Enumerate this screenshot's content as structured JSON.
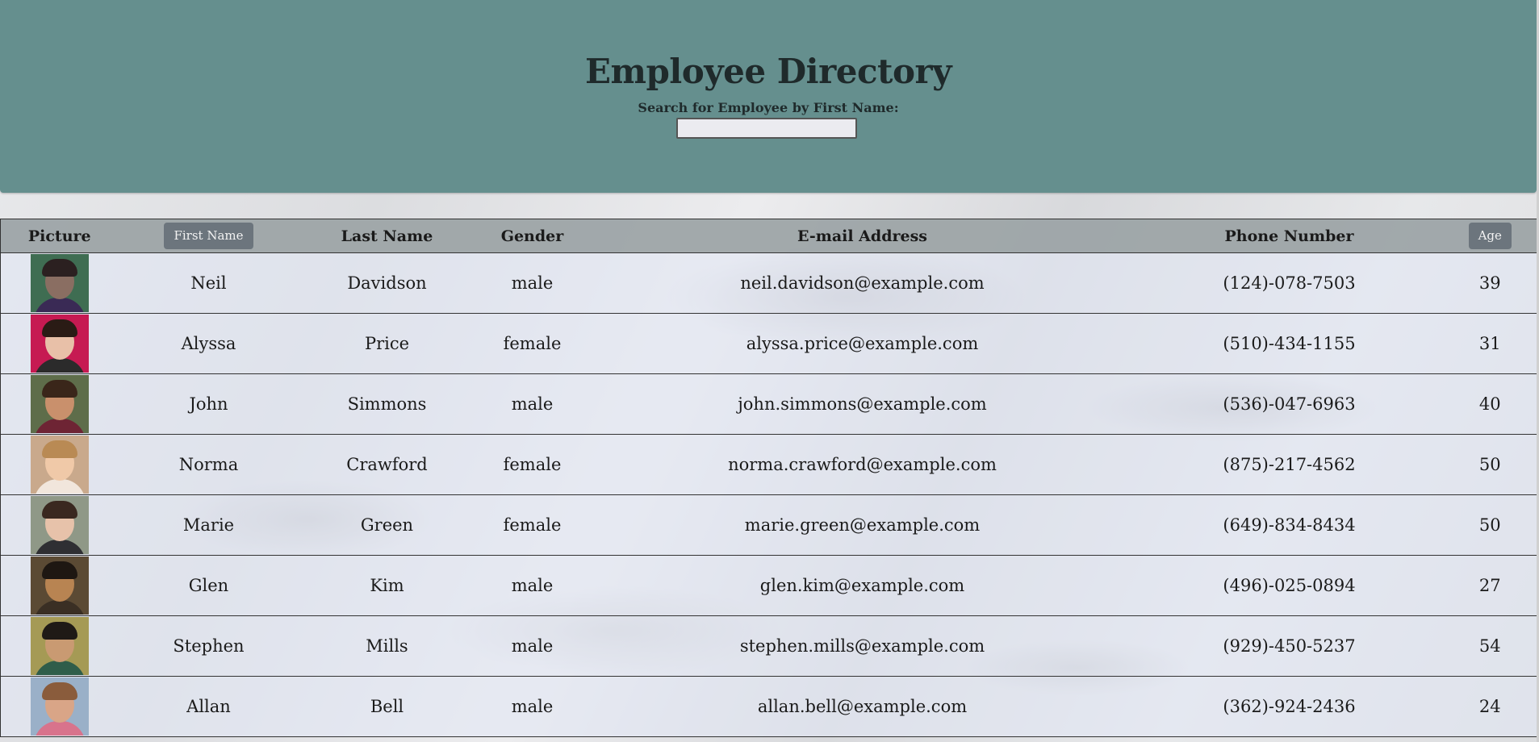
{
  "header": {
    "title": "Employee Directory",
    "search_label": "Search for Employee by First Name:",
    "search_value": "",
    "search_placeholder": ""
  },
  "table": {
    "columns": {
      "picture": "Picture",
      "first_name": "First Name",
      "last_name": "Last Name",
      "gender": "Gender",
      "email": "E-mail Address",
      "phone": "Phone Number",
      "age": "Age"
    },
    "rows": [
      {
        "first": "Neil",
        "last": "Davidson",
        "gender": "male",
        "email": "neil.davidson@example.com",
        "phone": "(124)-078-7503",
        "age": "39",
        "bg": "#3f6d52",
        "skin": "#8a6e62",
        "hair": "#2b2020",
        "shirt": "#3a2a55"
      },
      {
        "first": "Alyssa",
        "last": "Price",
        "gender": "female",
        "email": "alyssa.price@example.com",
        "phone": "(510)-434-1155",
        "age": "31",
        "bg": "#c61a52",
        "skin": "#e8c0a8",
        "hair": "#2a1b15",
        "shirt": "#2b2b2b"
      },
      {
        "first": "John",
        "last": "Simmons",
        "gender": "male",
        "email": "john.simmons@example.com",
        "phone": "(536)-047-6963",
        "age": "40",
        "bg": "#5e6d4a",
        "skin": "#c9906c",
        "hair": "#3a261a",
        "shirt": "#6e2434"
      },
      {
        "first": "Norma",
        "last": "Crawford",
        "gender": "female",
        "email": "norma.crawford@example.com",
        "phone": "(875)-217-4562",
        "age": "50",
        "bg": "#c9a98c",
        "skin": "#f0c9a8",
        "hair": "#b98a54",
        "shirt": "#f1e6dc"
      },
      {
        "first": "Marie",
        "last": "Green",
        "gender": "female",
        "email": "marie.green@example.com",
        "phone": "(649)-834-8434",
        "age": "50",
        "bg": "#8f9887",
        "skin": "#e7c2aa",
        "hair": "#3a2820",
        "shirt": "#2f2f33"
      },
      {
        "first": "Glen",
        "last": "Kim",
        "gender": "male",
        "email": "glen.kim@example.com",
        "phone": "(496)-025-0894",
        "age": "27",
        "bg": "#5b4a34",
        "skin": "#b88452",
        "hair": "#1e1712",
        "shirt": "#3a2f24"
      },
      {
        "first": "Stephen",
        "last": "Mills",
        "gender": "male",
        "email": "stephen.mills@example.com",
        "phone": "(929)-450-5237",
        "age": "54",
        "bg": "#a59a55",
        "skin": "#c99a72",
        "hair": "#1f1a16",
        "shirt": "#2f5d4a"
      },
      {
        "first": "Allan",
        "last": "Bell",
        "gender": "male",
        "email": "allan.bell@example.com",
        "phone": "(362)-924-2436",
        "age": "24",
        "bg": "#9ab0c8",
        "skin": "#d9a587",
        "hair": "#8a5c3c",
        "shirt": "#d8738c"
      }
    ]
  }
}
